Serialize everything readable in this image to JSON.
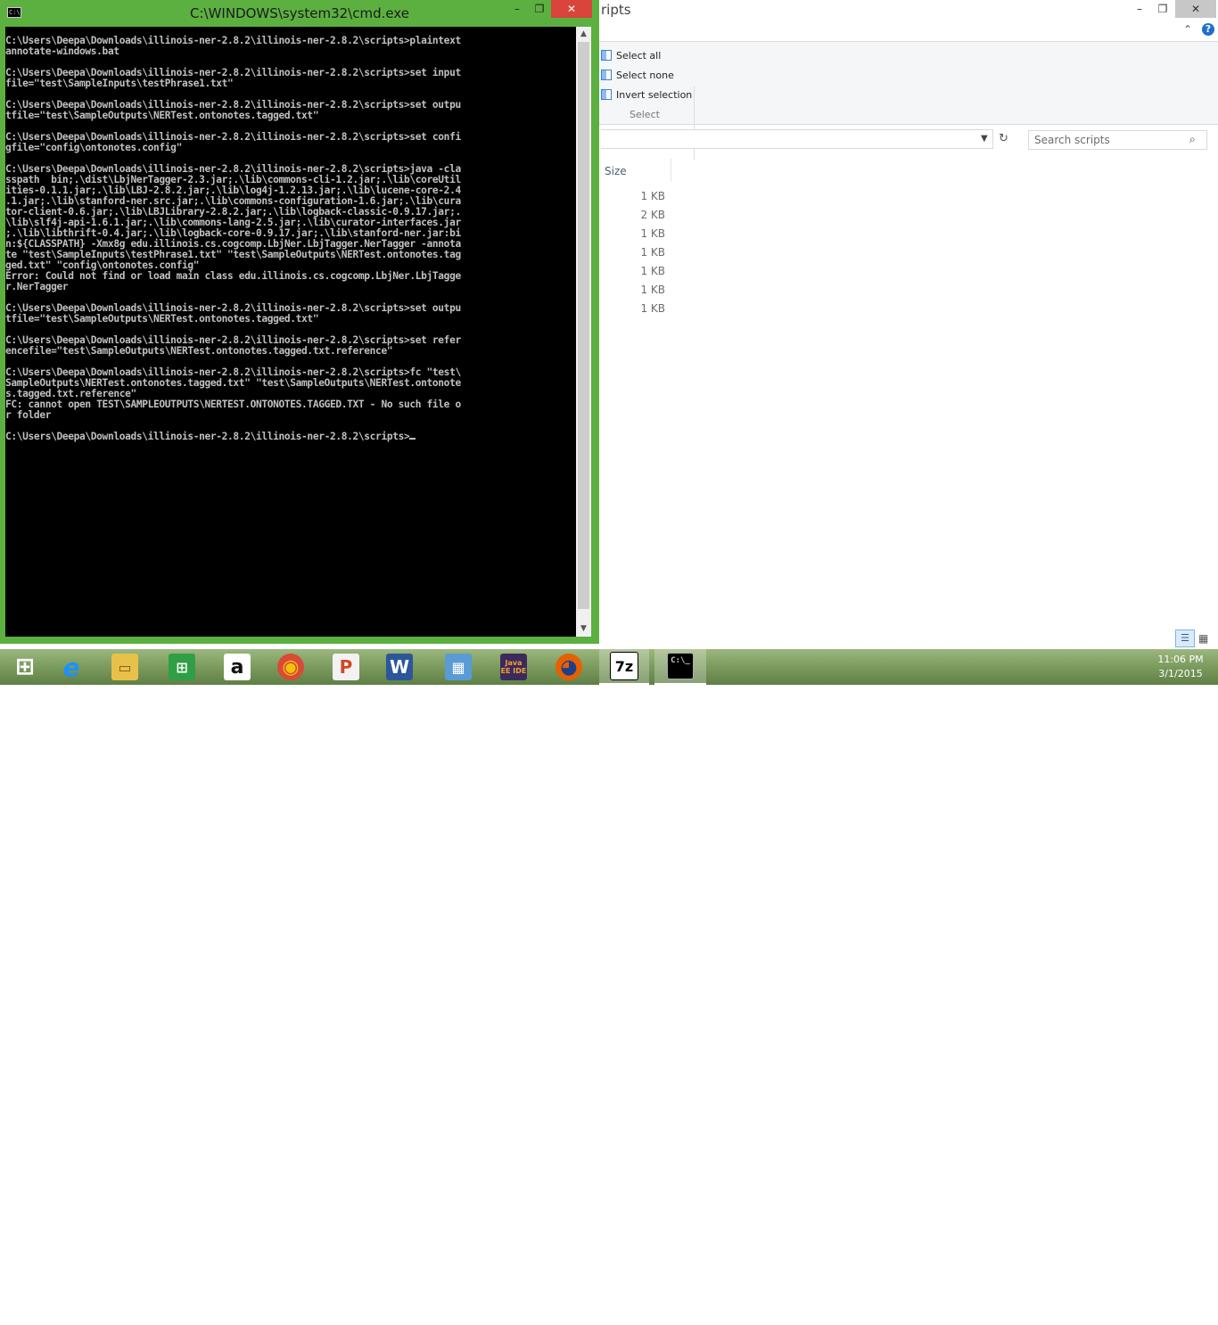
{
  "explorer": {
    "title": "ripts",
    "controls": {
      "minimize": "–",
      "maximize": "❐",
      "close": "✕"
    },
    "ribbon": {
      "select_all": "Select all",
      "select_none": "Select none",
      "invert_selection": "Invert selection",
      "group_label": "Select",
      "chevron": "⌃",
      "help": "?"
    },
    "search": {
      "placeholder": "Search scripts"
    },
    "columns": {
      "size": "Size"
    },
    "sizes": [
      "1 KB",
      "2 KB",
      "1 KB",
      "1 KB",
      "1 KB",
      "1 KB",
      "1 KB"
    ]
  },
  "cmd": {
    "title": "C:\\WINDOWS\\system32\\cmd.exe",
    "icon_text": "C:\\",
    "controls": {
      "minimize": "–",
      "maximize": "❐",
      "close": "✕"
    },
    "console_text": "C:\\Users\\Deepa\\Downloads\\illinois-ner-2.8.2\\illinois-ner-2.8.2\\scripts>plaintext\nannotate-windows.bat\n\nC:\\Users\\Deepa\\Downloads\\illinois-ner-2.8.2\\illinois-ner-2.8.2\\scripts>set input\nfile=\"test\\SampleInputs\\testPhrase1.txt\"\n\nC:\\Users\\Deepa\\Downloads\\illinois-ner-2.8.2\\illinois-ner-2.8.2\\scripts>set outpu\ntfile=\"test\\SampleOutputs\\NERTest.ontonotes.tagged.txt\"\n\nC:\\Users\\Deepa\\Downloads\\illinois-ner-2.8.2\\illinois-ner-2.8.2\\scripts>set confi\ngfile=\"config\\ontonotes.config\"\n\nC:\\Users\\Deepa\\Downloads\\illinois-ner-2.8.2\\illinois-ner-2.8.2\\scripts>java -cla\nsspath  bin;.\\dist\\LbjNerTagger-2.3.jar;.\\lib\\commons-cli-1.2.jar;.\\lib\\coreUtil\nities-0.1.1.jar;.\\lib\\LBJ-2.8.2.jar;.\\lib\\log4j-1.2.13.jar;.\\lib\\lucene-core-2.4\n.1.jar;.\\lib\\stanford-ner.src.jar;.\\lib\\commons-configuration-1.6.jar;.\\lib\\cura\ntor-client-0.6.jar;.\\lib\\LBJLibrary-2.8.2.jar;.\\lib\\logback-classic-0.9.17.jar;.\n\\lib\\slf4j-api-1.6.1.jar;.\\lib\\commons-lang-2.5.jar;.\\lib\\curator-interfaces.jar\n;.\\lib\\libthrift-0.4.jar;.\\lib\\logback-core-0.9.17.jar;.\\lib\\stanford-ner.jar:bi\nn:${CLASSPATH} -Xmx8g edu.illinois.cs.cogcomp.LbjNer.LbjTagger.NerTagger -annota\nte \"test\\SampleInputs\\testPhrase1.txt\" \"test\\SampleOutputs\\NERTest.ontonotes.tag\nged.txt\" \"config\\ontonotes.config\"\nError: Could not find or load main class edu.illinois.cs.cogcomp.LbjNer.LbjTagge\nr.NerTagger\n\nC:\\Users\\Deepa\\Downloads\\illinois-ner-2.8.2\\illinois-ner-2.8.2\\scripts>set outpu\ntfile=\"test\\SampleOutputs\\NERTest.ontonotes.tagged.txt\"\n\nC:\\Users\\Deepa\\Downloads\\illinois-ner-2.8.2\\illinois-ner-2.8.2\\scripts>set refer\nencefile=\"test\\SampleOutputs\\NERTest.ontonotes.tagged.txt.reference\"\n\nC:\\Users\\Deepa\\Downloads\\illinois-ner-2.8.2\\illinois-ner-2.8.2\\scripts>fc \"test\\\nSampleOutputs\\NERTest.ontonotes.tagged.txt\" \"test\\SampleOutputs\\NERTest.ontonote\ns.tagged.txt.reference\"\nFC: cannot open TEST\\SAMPLEOUTPUTS\\NERTEST.ONTONOTES.TAGGED.TXT - No such file o\nr folder\n\nC:\\Users\\Deepa\\Downloads\\illinois-ner-2.8.2\\illinois-ner-2.8.2\\scripts>"
  },
  "taskbar": {
    "apps": [
      {
        "name": "start",
        "icon": "windows-logo-icon",
        "label": "⊞",
        "color": "#ffffff"
      },
      {
        "name": "internet-explorer",
        "icon": "internet-explorer-icon",
        "label": "e",
        "color": "#1e90ff"
      },
      {
        "name": "file-explorer",
        "icon": "folder-icon",
        "label": "▭",
        "color": "#e8c14a"
      },
      {
        "name": "store",
        "icon": "store-icon",
        "label": "⊞",
        "color": "#2f9e44"
      },
      {
        "name": "amazon",
        "icon": "amazon-icon",
        "label": "a",
        "color": "#ffffff"
      },
      {
        "name": "chrome",
        "icon": "chrome-icon",
        "label": "◉",
        "color": "#d94a38"
      },
      {
        "name": "powerpoint",
        "icon": "powerpoint-icon",
        "label": "P",
        "color": "#d24726"
      },
      {
        "name": "word",
        "icon": "word-icon",
        "label": "W",
        "color": "#2b579a"
      },
      {
        "name": "control-panel",
        "icon": "control-panel-icon",
        "label": "▦",
        "color": "#5a9bd5"
      },
      {
        "name": "java-ee-ide",
        "icon": "java-ee-ide-icon",
        "label": "Java EE IDE",
        "color": "#3b2a5c"
      },
      {
        "name": "firefox",
        "icon": "firefox-icon",
        "label": "◕",
        "color": "#e66000"
      },
      {
        "name": "7zip",
        "icon": "7zip-icon",
        "label": "7z",
        "color": "#ffffff"
      },
      {
        "name": "cmd",
        "icon": "cmd-icon",
        "label": "C:\\_",
        "color": "#000000"
      }
    ],
    "clock_time": "11:06 PM",
    "clock_date": "3/1/2015"
  },
  "colors": {
    "cmd_frame": "#5cb040",
    "console_bg": "#000000",
    "console_fg": "#c0c0c0",
    "close_red": "#d9443b"
  }
}
